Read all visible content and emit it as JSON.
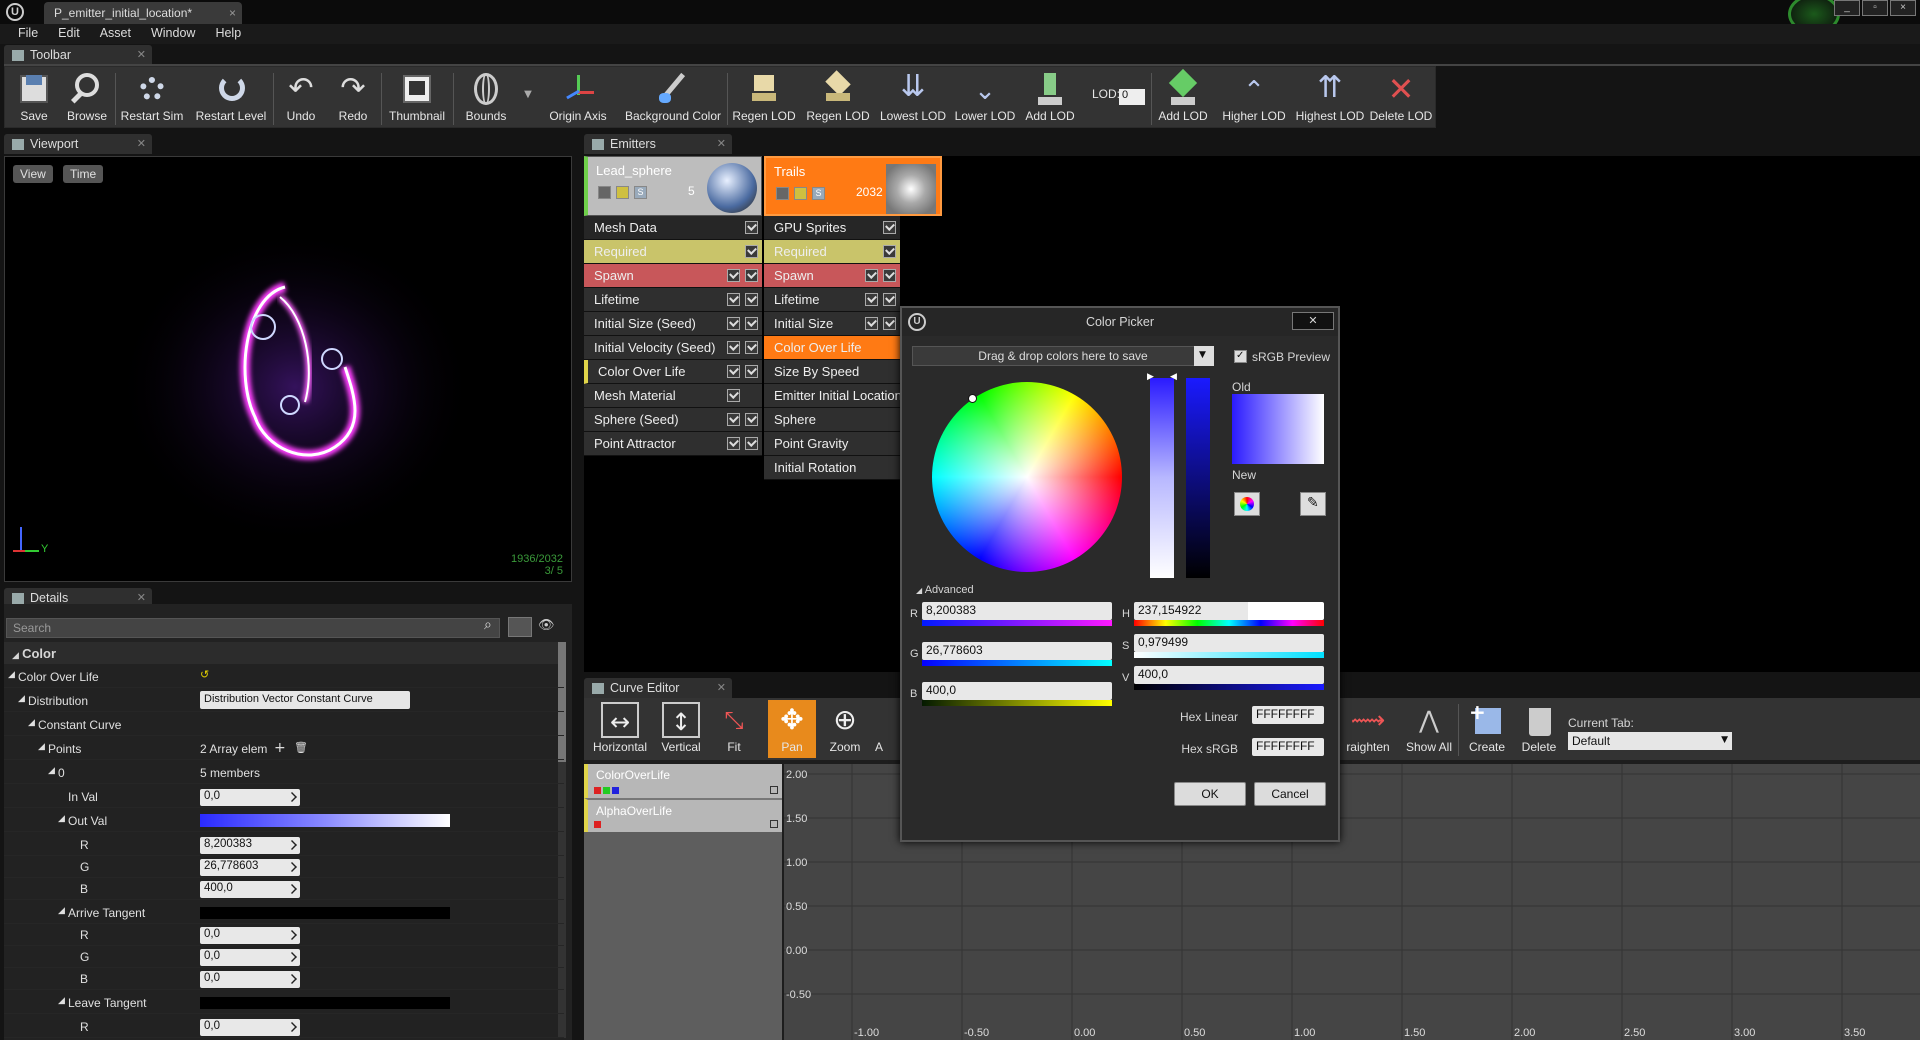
{
  "window": {
    "tab_title": "P_emitter_initial_location*",
    "close": "×"
  },
  "menu": [
    "File",
    "Edit",
    "Asset",
    "Window",
    "Help"
  ],
  "toolbar_tab": "Toolbar",
  "toolbar": [
    "Save",
    "Browse",
    "Restart Sim",
    "Restart Level",
    "Undo",
    "Redo",
    "Thumbnail",
    "Bounds",
    "Origin Axis",
    "Background Color",
    "Regen LOD",
    "Regen LOD",
    "Lowest LOD",
    "Lower LOD",
    "Add LOD",
    "LOD:",
    "0",
    "Add LOD",
    "Higher LOD",
    "Highest LOD",
    "Delete LOD"
  ],
  "viewport": {
    "tab": "Viewport",
    "view_btn": "View",
    "time_btn": "Time",
    "stats1": "1936/2032",
    "stats2": "3/  5",
    "axis_y": "Y"
  },
  "emitters": {
    "tab": "Emitters",
    "lead": {
      "name": "Lead_sphere",
      "count": "5",
      "s": "S",
      "modules": [
        "Mesh Data",
        "Required",
        "Spawn",
        "Lifetime",
        "Initial Size (Seed)",
        "Initial Velocity (Seed)",
        "Color Over Life",
        "Mesh Material",
        "Sphere (Seed)",
        "Point Attractor"
      ]
    },
    "trails": {
      "name": "Trails",
      "count": "2032",
      "s": "S",
      "modules": [
        "GPU Sprites",
        "Required",
        "Spawn",
        "Lifetime",
        "Initial Size",
        "Color Over Life",
        "Size By Speed",
        "Emitter Initial Location",
        "Sphere",
        "Point Gravity",
        "Initial Rotation"
      ]
    },
    "colors": {
      "required": "#c9c46a",
      "spawn": "#c8575a",
      "selected": "#ff7a14",
      "trails_head": "#ff7a14"
    }
  },
  "details": {
    "tab": "Details",
    "search_placeholder": "Search",
    "section": "Color",
    "rows": {
      "color_over_life": "Color Over Life",
      "distribution": "Distribution",
      "distribution_value": "Distribution Vector Constant Curve",
      "constant_curve": "Constant Curve",
      "points": "Points",
      "points_value": "2 Array elem",
      "p0": "0",
      "p0_value": "5 members",
      "in_val": "In Val",
      "in_val_value": "0,0",
      "out_val": "Out Val",
      "r": "R",
      "g": "G",
      "b": "B",
      "out_r": "8,200383",
      "out_g": "26,778603",
      "out_b": "400,0",
      "arrive": "Arrive Tangent",
      "ar": "0,0",
      "ag": "0,0",
      "ab": "0,0",
      "leave": "Leave Tangent",
      "lr": "0,0"
    }
  },
  "curve_editor": {
    "tab": "Curve Editor",
    "buttons": [
      "Horizontal",
      "Vertical",
      "Fit",
      "Pan",
      "Zoom",
      "A"
    ],
    "buttons_right": [
      "raighten",
      "Show All",
      "Create",
      "Delete"
    ],
    "current_tab_label": "Current Tab:",
    "current_tab_value": "Default",
    "tracks": [
      "ColorOverLife",
      "AlphaOverLife"
    ],
    "y_labels": [
      "2.00",
      "1.50",
      "1.00",
      "0.50",
      "0.00",
      "-0.50"
    ],
    "x_labels": [
      "-1.00",
      "-0.50",
      "0.00",
      "0.50",
      "1.00",
      "1.50",
      "2.00",
      "2.50",
      "3.00",
      "3.50"
    ]
  },
  "picker": {
    "title": "Color Picker",
    "close": "✕",
    "drop_hint": "Drag & drop colors here to save",
    "srgb": "sRGB Preview",
    "old": "Old",
    "new": "New",
    "advanced": "Advanced",
    "R": "8,200383",
    "G": "26,778603",
    "B": "400,0",
    "H": "237,154922",
    "S": "0,979499",
    "V": "400,0",
    "hex_linear_label": "Hex Linear",
    "hex_linear": "FFFFFFFF",
    "hex_srgb_label": "Hex sRGB",
    "hex_srgb": "FFFFFFFF",
    "ok": "OK",
    "cancel": "Cancel",
    "lbl_r": "R",
    "lbl_g": "G",
    "lbl_b": "B",
    "lbl_h": "H",
    "lbl_s": "S",
    "lbl_v": "V"
  }
}
